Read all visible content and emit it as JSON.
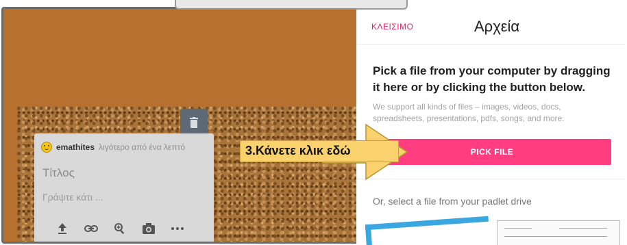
{
  "board": {
    "post": {
      "author": "emathites",
      "time": "λιγότερο από ένα λεπτό",
      "title_placeholder": "Τίτλος",
      "body_placeholder": "Γράψτε κάτι ..."
    }
  },
  "callout": {
    "text": "3.Κάνετε κλικ εδώ"
  },
  "panel": {
    "close_label": "ΚΛΕΙΣΙΜΟ",
    "title": "Αρχεία",
    "heading": "Pick a file from your computer by dragging it here or by clicking the button below.",
    "subtext": "We support all kinds of files – images, videos, docs, spreadsheets, presentations, pdfs, songs, and more.",
    "pick_button": "PICK FILE",
    "drive_text": "Or, select a file from your padlet drive"
  },
  "colors": {
    "accent": "#ff3d7f",
    "close_link": "#e91e63",
    "callout": "#f9d26e",
    "board": "#b8702e"
  }
}
